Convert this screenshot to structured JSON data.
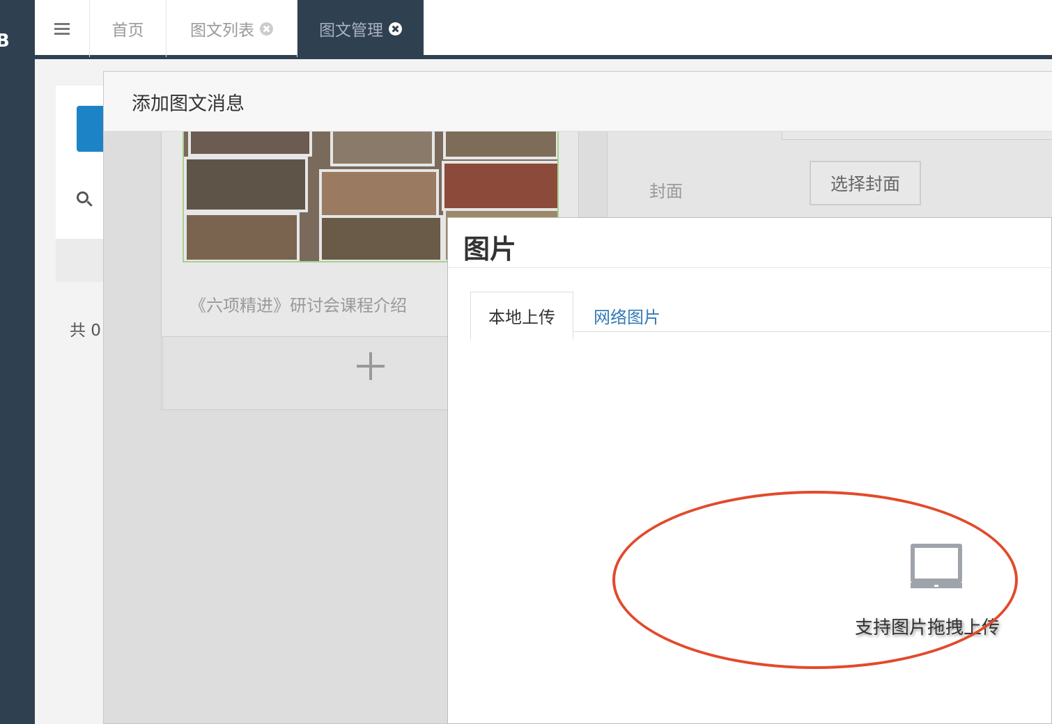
{
  "sidebar": {
    "mark": "B"
  },
  "topbar": {
    "menu_icon": "hamburger-icon",
    "tabs": [
      {
        "label": "首页"
      },
      {
        "label": "图文列表",
        "close_icon": "close-circle-icon"
      },
      {
        "label": "图文管理",
        "close_icon": "close-circle-icon",
        "active": true
      }
    ]
  },
  "page": {
    "search_icon": "search-icon",
    "total_text": "共 0"
  },
  "add_modal": {
    "title": "添加图文消息",
    "article_title": "《六项精进》研讨会课程介绍",
    "add_icon": "plus-icon",
    "cover_label": "封面",
    "cover_button": "选择封面"
  },
  "image_dialog": {
    "title": "图片",
    "tabs": [
      {
        "label": "本地上传",
        "active": true
      },
      {
        "label": "网络图片"
      }
    ],
    "upload_icon": "monitor-icon",
    "drag_hint": "支持图片拖拽上传"
  },
  "colors": {
    "sidebar": "#2f4050",
    "link": "#337ab7",
    "highlight": "#e24a2b"
  }
}
